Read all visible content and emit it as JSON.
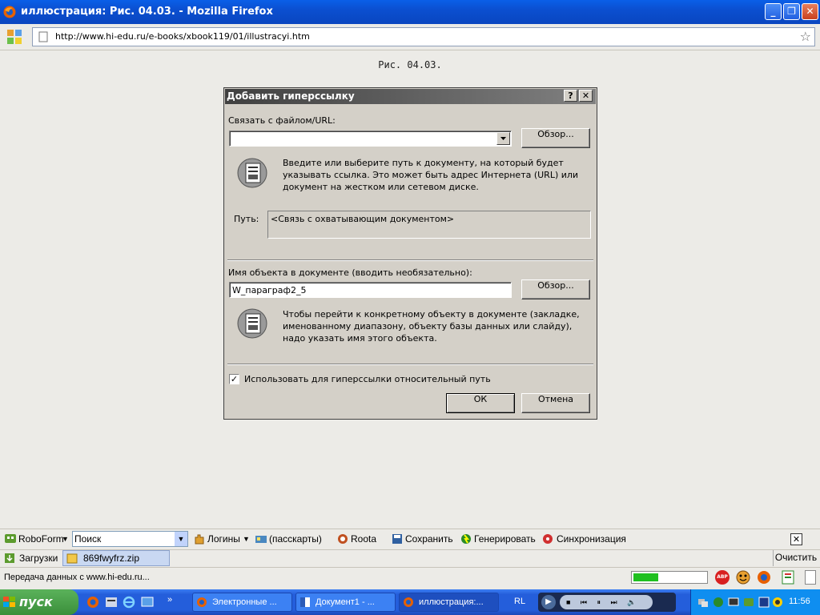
{
  "window": {
    "title": "иллюстрация: Рис. 04.03. - Mozilla Firefox",
    "min_label": "_",
    "max_label": "❐",
    "close_label": "✕"
  },
  "nav": {
    "url": "http://www.hi-edu.ru/e-books/xbook119/01/illustracyi.htm",
    "star_icon": "☆"
  },
  "page": {
    "caption": "Рис. 04.03."
  },
  "dialog": {
    "title": "Добавить гиперссылку",
    "help_btn": "?",
    "close_btn": "✕",
    "link_label": "Связать с файлом/URL:",
    "link_value": "",
    "browse_label": "Обзор...",
    "link_help": "Введите или выберите путь к документу, на который будет указывать ссылка. Это может быть адрес Интернета (URL) или документ на жестком или сетевом диске.",
    "path_label": "Путь:",
    "path_value": "<Связь с охватывающим документом>",
    "object_label": "Имя объекта в документе (вводить необязательно):",
    "object_value": "W_параграф2_5",
    "object_browse_label": "Обзор...",
    "object_help": "Чтобы перейти к конкретному объекту в документе (закладке, именованному диапазону, объекту базы данных или слайду), надо указать имя этого объекта.",
    "relative_path_label": "Использовать для гиперссылки относительный путь",
    "relative_path_checked": true,
    "ok_label": "ОК",
    "cancel_label": "Отмена"
  },
  "roboform": {
    "brand": "RoboForm",
    "search_placeholder": "Поиск",
    "logins": "Логины",
    "passcards": "(пасскарты)",
    "roota": "Roota",
    "save": "Сохранить",
    "generate": "Генерировать",
    "sync": "Синхронизация",
    "close": "✕"
  },
  "downloads": {
    "label": "Загрузки",
    "file": "869fwyfrz.zip",
    "clear": "Очистить"
  },
  "status": {
    "text": "Передача данных с www.hi-edu.ru...",
    "progress": 0.35,
    "abp": "ABP"
  },
  "taskbar": {
    "start": "пуск",
    "more": "»",
    "tasks": [
      {
        "label": "Электронные ..."
      },
      {
        "label": "Документ1 - ..."
      },
      {
        "label": "иллюстрация:..."
      }
    ],
    "lang": "RL",
    "clock": "11:56"
  },
  "colors": {
    "accent": "#0a46c0",
    "progress_green": "#20c020"
  }
}
